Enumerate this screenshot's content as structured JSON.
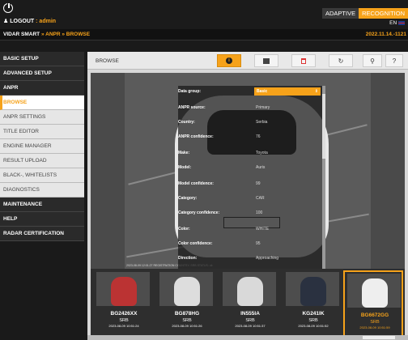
{
  "header": {
    "logout_label": "LOGOUT",
    "user_sep": " : ",
    "user": "admin",
    "brand_a": "ADAPTIVE",
    "brand_b": "RECOGNITION",
    "language": "EN"
  },
  "breadcrumb": {
    "root": "VIDAR SMART",
    "sep1": " » ",
    "section": "ANPR",
    "sep2": " » ",
    "page": "BROWSE",
    "datetime": "2022.11.14.-1121"
  },
  "sidebar": {
    "items": [
      {
        "label": "BASIC SETUP",
        "style": "dark"
      },
      {
        "label": "ADVANCED SETUP",
        "style": "dark"
      },
      {
        "label": "ANPR",
        "style": "dark"
      },
      {
        "label": "BROWSE",
        "style": "active"
      },
      {
        "label": "ANPR SETTINGS",
        "style": "light"
      },
      {
        "label": "TITLE EDITOR",
        "style": "light"
      },
      {
        "label": "ENGINE MANAGER",
        "style": "light"
      },
      {
        "label": "RESULT UPLOAD",
        "style": "light"
      },
      {
        "label": "BLACK-, WHITELISTS",
        "style": "light"
      },
      {
        "label": "DIAGNOSTICS",
        "style": "light"
      },
      {
        "label": "MAINTENANCE",
        "style": "dark"
      },
      {
        "label": "HELP",
        "style": "dark"
      },
      {
        "label": "RADAR CERTIFICATION",
        "style": "dark"
      }
    ]
  },
  "toolbar": {
    "title": "BROWSE",
    "buttons": [
      {
        "icon": "info-icon",
        "selected": true
      },
      {
        "icon": "grid-icon",
        "selected": false
      },
      {
        "icon": "trash-icon",
        "selected": false
      },
      {
        "icon": "refresh-icon",
        "glyph": "↻",
        "selected": false
      },
      {
        "icon": "search-icon",
        "glyph": "⚲",
        "selected": false
      },
      {
        "icon": "help-icon",
        "glyph": "?",
        "selected": false
      }
    ]
  },
  "viewer": {
    "caption": "2023-08-09 12:01:27 REGISTRATION COUNTRY: SRB STATUS: ok"
  },
  "data_panel": {
    "rows": [
      {
        "label": "Data group:",
        "value": "Basic",
        "select": true
      },
      {
        "label": "ANPR source:",
        "value": "Primary"
      },
      {
        "label": "Country:",
        "value": "Serbia"
      },
      {
        "label": "ANPR confidence:",
        "value": "76"
      },
      {
        "label": "Make:",
        "value": "Toyota"
      },
      {
        "label": "Model:",
        "value": "Auris"
      },
      {
        "label": "Model confidence:",
        "value": "99"
      },
      {
        "label": "Category:",
        "value": "CAR"
      },
      {
        "label": "Category confidence:",
        "value": "100"
      },
      {
        "label": "Color:",
        "value": "WHITE"
      },
      {
        "label": "Color confidence:",
        "value": "95"
      },
      {
        "label": "Direction:",
        "value": "Approaching"
      }
    ]
  },
  "thumbnails": [
    {
      "plate": "BG2426XX",
      "country": "SRB",
      "time": "2023-08-09 10:51:24",
      "car_color": "#b33",
      "active": false
    },
    {
      "plate": "BG878HG",
      "country": "SRB",
      "time": "2023-08-09 10:51:26",
      "car_color": "#ddd",
      "active": false
    },
    {
      "plate": "IN555IA",
      "country": "SRB",
      "time": "2023-08-09 10:51:37",
      "car_color": "#d9d9d9",
      "active": false
    },
    {
      "plate": "KG241IK",
      "country": "SRB",
      "time": "2023-08-09 10:51:52",
      "car_color": "#2a3140",
      "active": false
    },
    {
      "plate": "BG6672GG",
      "country": "SRB",
      "time": "2023-08-09 10:51:59",
      "car_color": "#eee",
      "active": true
    }
  ],
  "colors": {
    "accent": "#f6a21a",
    "dark_nav": "#2a2a2a",
    "light_nav": "#e6e6e6"
  }
}
